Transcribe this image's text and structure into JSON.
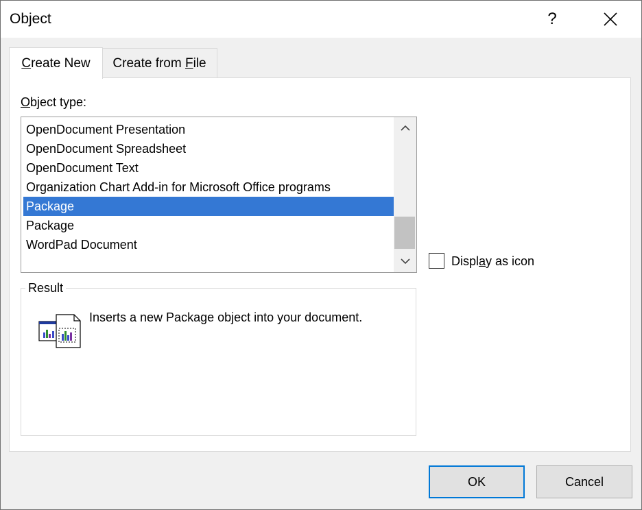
{
  "window": {
    "title": "Object",
    "help_label": "?"
  },
  "tabs": [
    {
      "label_pre": "",
      "label_key": "C",
      "label_post": "reate New",
      "active": true
    },
    {
      "label_pre": "Create from ",
      "label_key": "F",
      "label_post": "ile",
      "active": false
    }
  ],
  "object_type": {
    "label_key": "O",
    "label_post": "bject type:",
    "items": [
      "OpenDocument Presentation",
      "OpenDocument Spreadsheet",
      "OpenDocument Text",
      "Organization Chart Add-in for Microsoft Office programs",
      "Package",
      "Package",
      "WordPad Document"
    ],
    "selected_index": 4
  },
  "display_as_icon": {
    "label_pre": "Displ",
    "label_key": "a",
    "label_post": "y as icon",
    "checked": false
  },
  "result": {
    "legend": "Result",
    "text": "Inserts a new Package object into your document."
  },
  "buttons": {
    "ok": "OK",
    "cancel": "Cancel"
  },
  "colors": {
    "selection": "#3478d4",
    "default_button_border": "#0078d7"
  }
}
